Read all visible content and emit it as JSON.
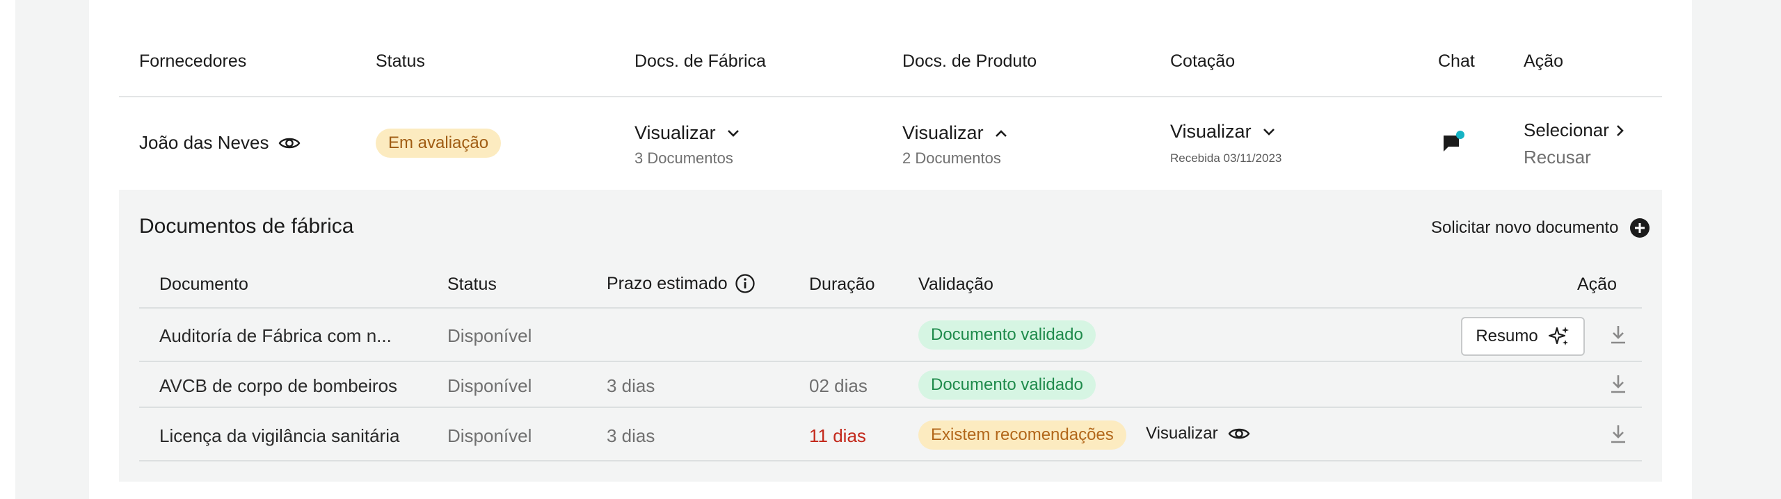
{
  "table": {
    "headers": [
      "Fornecedores",
      "Status",
      "Docs. de Fábrica",
      "Docs. de Produto",
      "Cotação",
      "Chat",
      "Ação"
    ],
    "row": {
      "supplier": "João das Neves",
      "status": "Em avaliação",
      "factory_docs": {
        "link": "Visualizar",
        "count": "3 Documentos",
        "expanded": false
      },
      "product_docs": {
        "link": "Visualizar",
        "count": "2 Documentos",
        "expanded": true
      },
      "quote": {
        "link": "Visualizar",
        "received": "Recebida 03/11/2023"
      },
      "actions": {
        "select": "Selecionar",
        "reject": "Recusar"
      }
    }
  },
  "panel": {
    "title": "Documentos de fábrica",
    "request_button": "Solicitar novo documento",
    "headers": {
      "documento": "Documento",
      "status": "Status",
      "prazo": "Prazo estimado",
      "duracao": "Duração",
      "validacao": "Validação",
      "acao": "Ação"
    },
    "rows": [
      {
        "documento": "Auditoría de Fábrica com n...",
        "status": "Disponível",
        "prazo": "",
        "duracao": "",
        "validacao": "Documento validado",
        "resumo": "Resumo"
      },
      {
        "documento": "AVCB de corpo de bombeiros",
        "status": "Disponível",
        "prazo": "3 dias",
        "duracao": "02 dias",
        "validacao": "Documento validado"
      },
      {
        "documento": "Licença da vigilância sanitária",
        "status": "Disponível",
        "prazo": "3 dias",
        "duracao": "11 dias",
        "validacao": "Existem recomendações",
        "visualizar": "Visualizar"
      }
    ]
  },
  "colors": {
    "accent_chat_dot": "#16b3c4",
    "eval_pill_bg": "#fcebc0",
    "ok_pill_bg": "#d6f5e3",
    "danger_text": "#c3291c"
  },
  "icons": [
    "eye-icon",
    "chevron-down-icon",
    "chevron-up-icon",
    "chat-icon",
    "chevron-right-icon",
    "plus-circle-icon",
    "info-icon",
    "sparkle-icon",
    "download-icon"
  ]
}
